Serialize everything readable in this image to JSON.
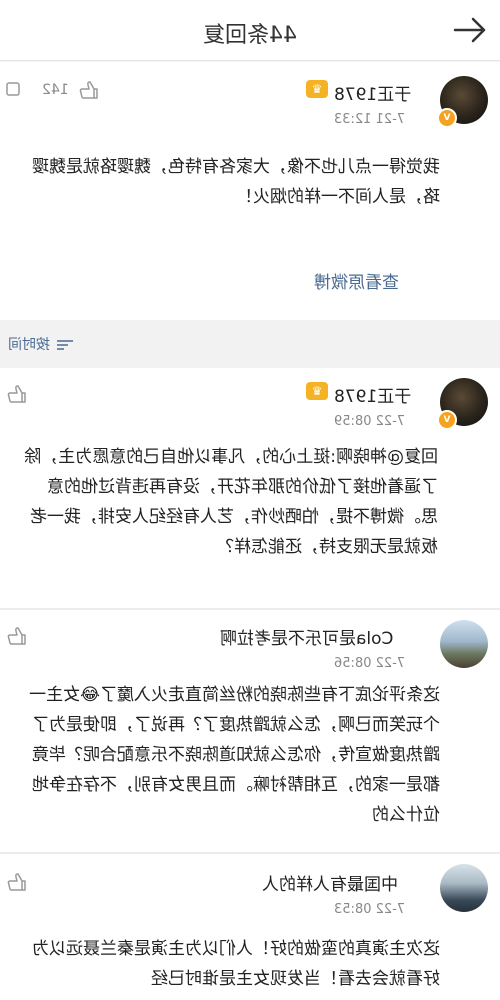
{
  "header": {
    "title": "44条回复"
  },
  "featured": {
    "username": "于正1978",
    "timestamp": "7-21 12:33",
    "likes": "142",
    "text": "我觉得一点儿也不像，大家各有特色，魏璎珞就是魏璎珞，是人间不一样的烟火！",
    "view_original": "查看原微博"
  },
  "sort": {
    "label": "按时间"
  },
  "replies": [
    {
      "username": "于正1978",
      "timestamp": "7-22 08:59",
      "text": "回复@神晓啊:挺上心的，凡事以他自己的意愿为主，除了逼着他接了低价的那年花开，没有再违背过他的意思。微博不提，怕晒炒作，艺人有经纪人安排，我一老板就是无限支持，还能怎样？"
    },
    {
      "username": "Cola是可乐不是考拉啊",
      "timestamp": "7-22 08:56",
      "text": "这条评论底下有些陈晓的粉丝简直走火入魔了😂女主一个玩笑而已啊，怎么就蹭热度了？再说了，即使是为了蹭热度做宣传，你怎么就知道陈晓不乐意配合呢？毕竟都是一家的，互相帮衬嘛。而且男女有别，不存在争地位什么的"
    },
    {
      "username": "中国最有人样的人",
      "timestamp": "7-22 08:53",
      "text": "这次主演真的蛮做的好！人们以为主演是秦兰聂远以为好看就会去看！当发现女主是谁时已经"
    }
  ],
  "colors": {
    "link": "#4a6b91",
    "crown": "#f5b324",
    "verified": "#f7a21e"
  },
  "icons": {
    "back": "arrow-right-icon",
    "like": "thumbs-up-icon",
    "sort": "sort-icon",
    "comment": "comment-icon"
  }
}
